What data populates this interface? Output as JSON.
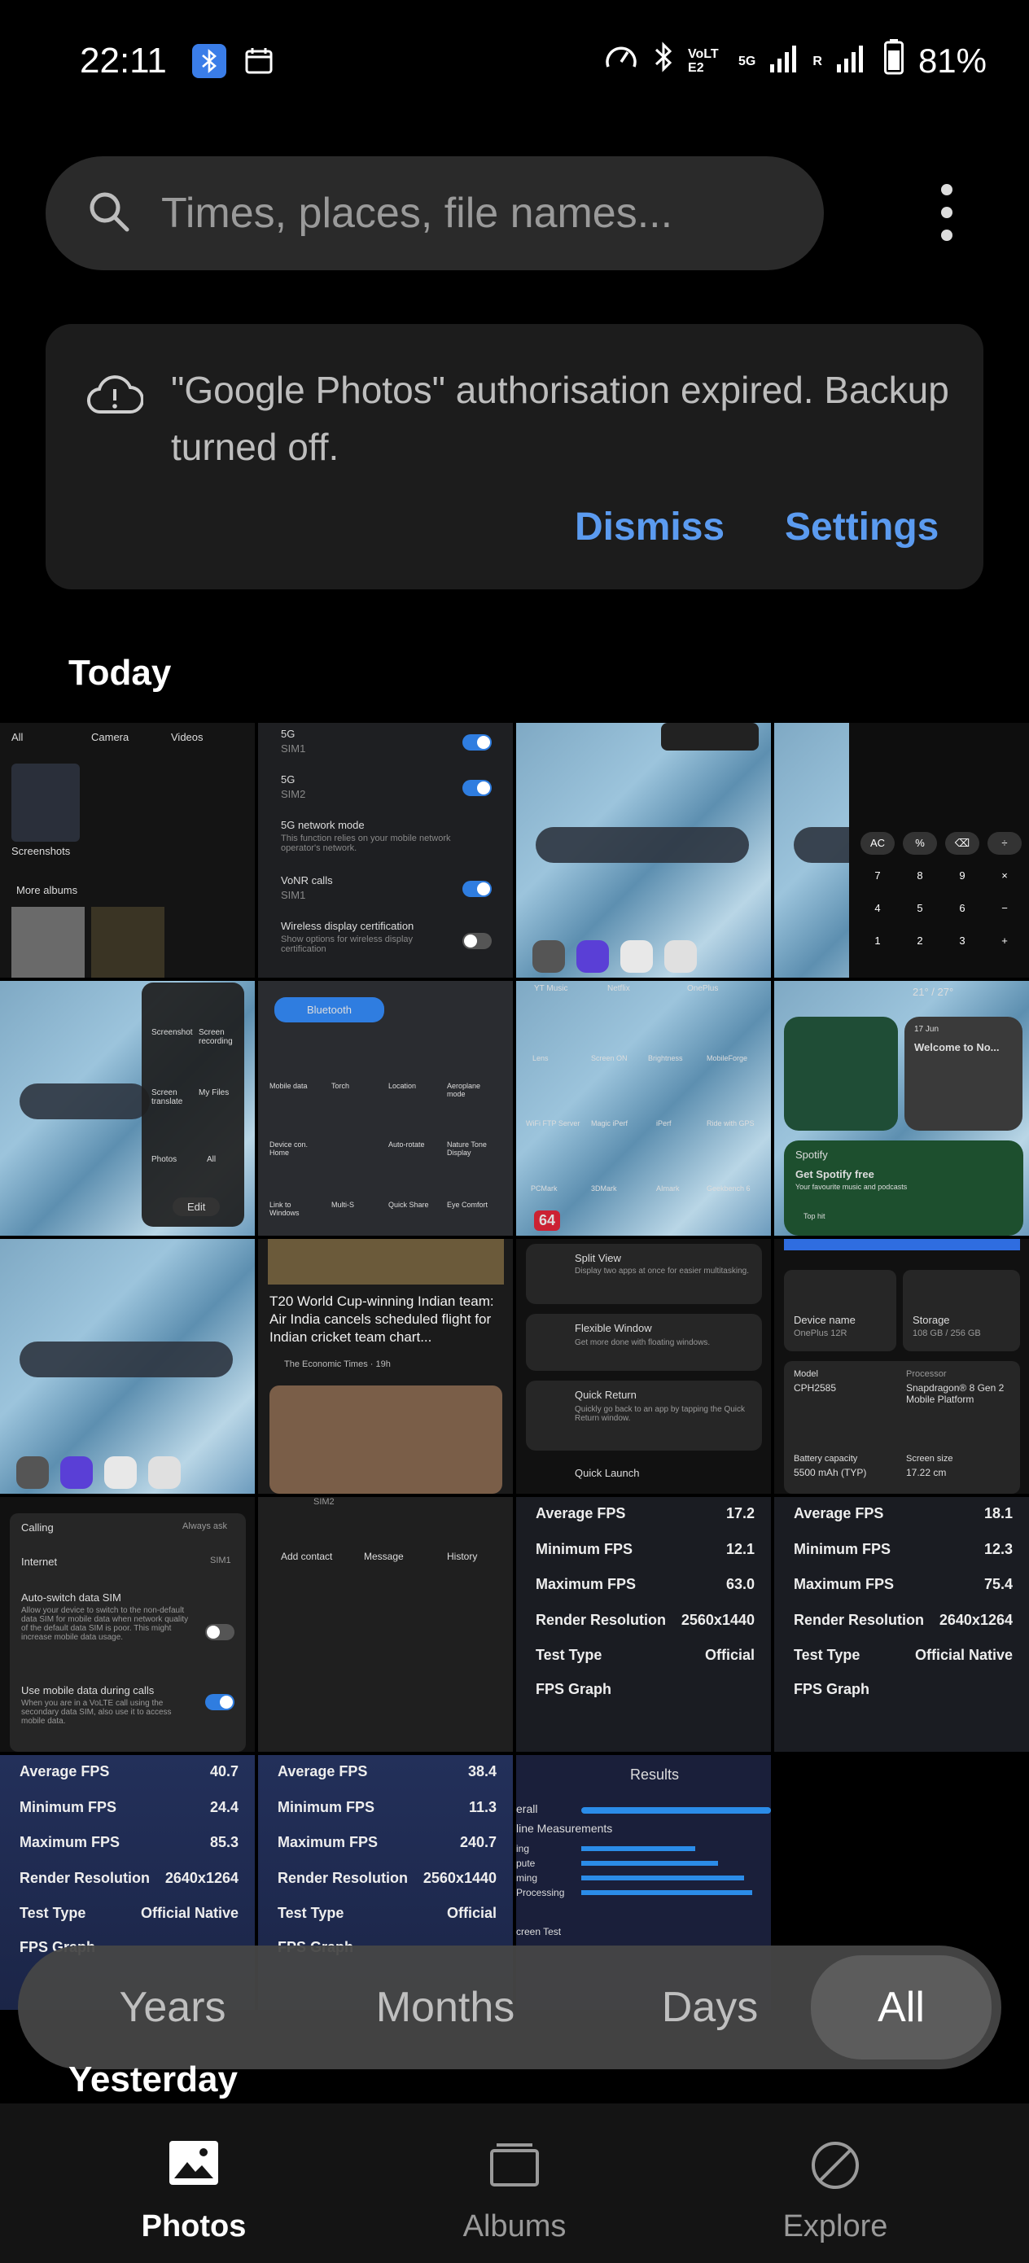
{
  "status_bar": {
    "time": "22:11",
    "network_label": "VoLTE2",
    "network_type": "5G",
    "roaming": "R",
    "battery": "81%"
  },
  "search": {
    "placeholder": "Times, places, file names..."
  },
  "notice": {
    "message": "\"Google Photos\" authorisation expired. Backup turned off.",
    "dismiss_label": "Dismiss",
    "settings_label": "Settings"
  },
  "sections": {
    "today": "Today",
    "yesterday": "Yesterday"
  },
  "thumbs": {
    "t1": {
      "all": "All",
      "camera": "Camera",
      "videos": "Videos",
      "screenshots": "Screenshots",
      "more_albums": "More albums"
    },
    "t2": {
      "r1": "5G",
      "r1s": "SIM1",
      "r2": "5G",
      "r2s": "SIM2",
      "r3": "5G network mode",
      "r3s": "This function relies on your mobile network operator's network.",
      "r4": "VoNR calls",
      "r4s": "SIM1",
      "r5": "Wireless display certification",
      "r5s": "Show options for wireless display certification"
    },
    "t5": {
      "a": "Screenshot",
      "b": "Screen recording",
      "c": "Screen translate",
      "d": "My Files",
      "e": "Photos",
      "f": "All",
      "edit": "Edit"
    },
    "t6": {
      "bt": "Bluetooth",
      "a": "Mobile data",
      "b": "Torch",
      "c": "Location",
      "d": "Aeroplane mode",
      "e": "Device con. Home",
      "f": "Auto-rotate",
      "g": "Nature Tone Display",
      "h": "Link to Windows",
      "i": "Multi-S",
      "j": "Quick Share",
      "k": "Eye Comfort"
    },
    "t7": {
      "a": "YT Music",
      "b": "Netflix",
      "c": "OnePlus",
      "d": "Lens",
      "e": "Screen ON",
      "f": "Brightness",
      "g": "MobileForge",
      "h": "WiFi FTP Server",
      "i": "Magic iPerf",
      "j": "iPerf",
      "k": "Ride with GPS",
      "l": "PCMark",
      "m": "3DMark",
      "n": "AImark",
      "o": "Geekbench 6",
      "badge": "64"
    },
    "t8": {
      "temp": "21° / 27°",
      "date": "17 Jun",
      "welcome": "Welcome to No...",
      "spotify": "Spotify",
      "get": "Get Spotify free",
      "sub": "Your favourite music and podcasts",
      "top": "Top hit"
    },
    "t10": {
      "headline": "T20 World Cup-winning Indian team: Air India cancels scheduled flight for Indian cricket team chart...",
      "source": "The Economic Times · 19h"
    },
    "t11": {
      "a": "Split View",
      "as": "Display two apps at once for easier multitasking.",
      "b": "Flexible Window",
      "bs": "Get more done with floating windows.",
      "c": "Quick Return",
      "cs": "Quickly go back to an app by tapping the Quick Return window.",
      "d": "Quick Launch"
    },
    "t12": {
      "device": "Device name",
      "device_v": "OnePlus 12R",
      "storage": "Storage",
      "storage_v": "108 GB / 256 GB",
      "model": "Model",
      "model_v": "CPH2585",
      "proc": "Processor",
      "proc_v": "Snapdragon® 8 Gen 2 Mobile Platform",
      "batt": "Battery capacity",
      "batt_v": "5500 mAh (TYP)",
      "screen": "Screen size",
      "screen_v": "17.22 cm"
    },
    "t13": {
      "calling": "Calling",
      "always": "Always ask",
      "internet": "Internet",
      "sim1": "SIM1",
      "auto": "Auto-switch data SIM",
      "auto_s": "Allow your device to switch to the non-default data SIM for mobile data when network quality of the default data SIM is poor. This might increase mobile data usage.",
      "use": "Use mobile data during calls",
      "use_s": "When you are in a VoLTE call using the secondary data SIM, also use it to access mobile data."
    },
    "t14": {
      "sim": "SIM2",
      "a": "Add contact",
      "b": "Message",
      "c": "History"
    },
    "fps_labels": {
      "avg": "Average FPS",
      "min": "Minimum FPS",
      "max": "Maximum FPS",
      "res": "Render Resolution",
      "type": "Test Type",
      "graph": "FPS Graph"
    },
    "fps1": {
      "avg": "17.2",
      "min": "12.1",
      "max": "63.0",
      "res": "2560x1440",
      "type": "Official"
    },
    "fps2": {
      "avg": "18.1",
      "min": "12.3",
      "max": "75.4",
      "res": "2640x1264",
      "type": "Official Native"
    },
    "fps3": {
      "avg": "40.7",
      "min": "24.4",
      "max": "85.3",
      "res": "2640x1264",
      "type": "Official Native"
    },
    "fps4": {
      "avg": "38.4",
      "min": "11.3",
      "max": "240.7",
      "res": "2560x1440",
      "type": "Official"
    },
    "t19": {
      "results": "Results",
      "overall": "erall",
      "online": "line Measurements",
      "a": "ing",
      "b": "pute",
      "c": "ming",
      "d": "Processing",
      "e": "creen Test"
    }
  },
  "segmented": {
    "years": "Years",
    "months": "Months",
    "days": "Days",
    "all": "All",
    "selected": "All"
  },
  "nav": {
    "photos": "Photos",
    "albums": "Albums",
    "explore": "Explore",
    "selected": "Photos"
  }
}
